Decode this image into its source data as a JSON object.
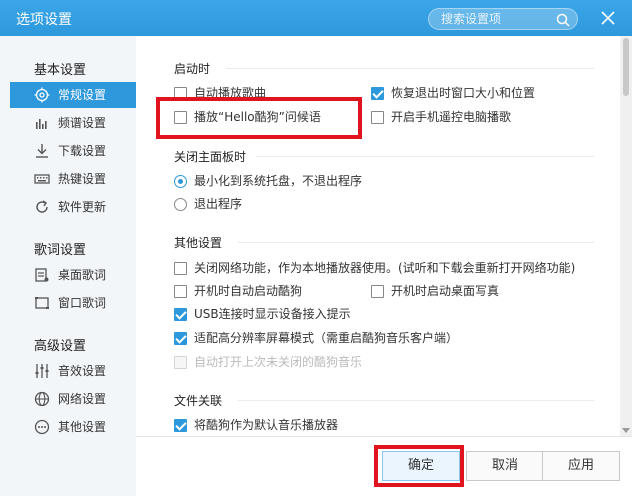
{
  "window": {
    "title": "选项设置",
    "search_placeholder": "搜索设置项",
    "accent_color": "#2e98dc",
    "highlight_color": "#e0141e"
  },
  "sidebar": {
    "groups": [
      {
        "label": "基本设置",
        "items": [
          {
            "label": "常规设置",
            "icon": "gear-icon",
            "active": true
          },
          {
            "label": "频谱设置",
            "icon": "spectrum-icon"
          },
          {
            "label": "下载设置",
            "icon": "download-icon"
          },
          {
            "label": "热键设置",
            "icon": "keyboard-icon"
          },
          {
            "label": "软件更新",
            "icon": "update-icon"
          }
        ]
      },
      {
        "label": "歌词设置",
        "items": [
          {
            "label": "桌面歌词",
            "icon": "desktop-lyrics-icon"
          },
          {
            "label": "窗口歌词",
            "icon": "window-lyrics-icon"
          }
        ]
      },
      {
        "label": "高级设置",
        "items": [
          {
            "label": "音效设置",
            "icon": "equalizer-icon"
          },
          {
            "label": "网络设置",
            "icon": "network-icon"
          },
          {
            "label": "其他设置",
            "icon": "more-icon"
          }
        ]
      }
    ]
  },
  "content": {
    "startup": {
      "title": "启动时",
      "options": [
        {
          "label": "自动播放歌曲",
          "checked": false
        },
        {
          "label": "恢复退出时窗口大小和位置",
          "checked": true
        },
        {
          "label": "播放“Hello酷狗”问候语",
          "checked": false
        },
        {
          "label": "开启手机遥控电脑播歌",
          "checked": false
        }
      ]
    },
    "close_panel": {
      "title": "关闭主面板时",
      "options": [
        {
          "label": "最小化到系统托盘，不退出程序",
          "selected": true
        },
        {
          "label": "退出程序",
          "selected": false
        }
      ]
    },
    "other": {
      "title": "其他设置",
      "options": [
        {
          "label": "关闭网络功能，作为本地播放器使用。(试听和下载会重新打开网络功能)",
          "checked": false
        },
        {
          "label": "开机时自动启动酷狗",
          "checked": false
        },
        {
          "label": "开机时启动桌面写真",
          "checked": false
        },
        {
          "label": "USB连接时显示设备接入提示",
          "checked": true
        },
        {
          "label": "适配高分辨率屏幕模式（需重启酷狗音乐客户端）",
          "checked": true
        },
        {
          "label": "自动打开上次未关闭的酷狗音乐",
          "checked": false,
          "disabled": true
        }
      ]
    },
    "file_assoc": {
      "title": "文件关联",
      "options": [
        {
          "label": "将酷狗作为默认音乐播放器",
          "checked": true
        }
      ]
    }
  },
  "footer": {
    "ok_label": "确定",
    "cancel_label": "取消",
    "apply_label": "应用"
  }
}
